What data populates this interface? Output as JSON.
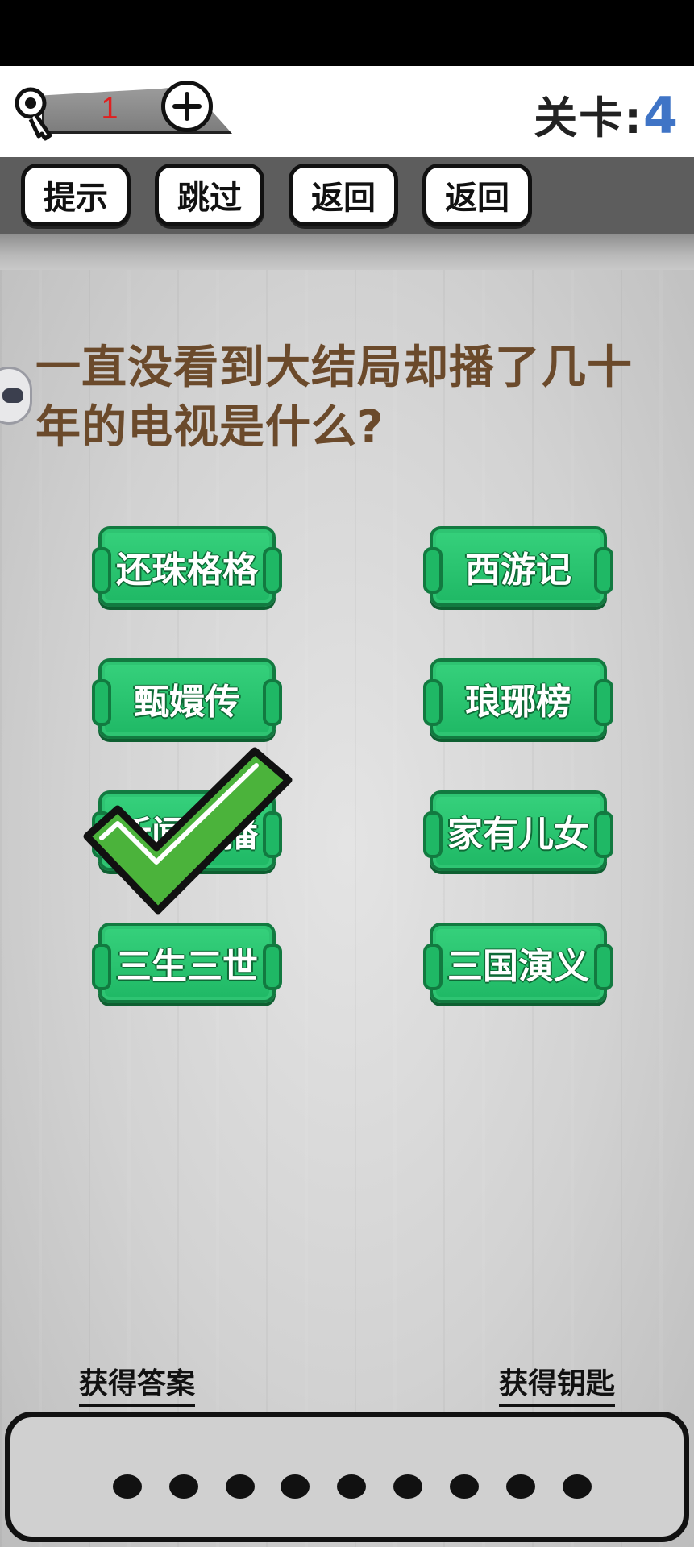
{
  "header": {
    "key_count": "1",
    "level_label": "关卡:",
    "level_number": "4"
  },
  "toolbar": {
    "buttons": [
      "提示",
      "跳过",
      "返回",
      "返回"
    ]
  },
  "question": {
    "text": "一直没看到大结局却播了几十年的电视是什么?"
  },
  "answers": [
    {
      "label": "还珠格格"
    },
    {
      "label": "西游记"
    },
    {
      "label": "甄嬛传"
    },
    {
      "label": "琅琊榜"
    },
    {
      "label": "新闻联播",
      "selected": true
    },
    {
      "label": "家有儿女"
    },
    {
      "label": "三生三世"
    },
    {
      "label": "三国演义"
    }
  ],
  "footer": {
    "get_answer": "获得答案",
    "get_key": "获得钥匙"
  },
  "answer_slots": 9,
  "colors": {
    "answer_green": "#22bb69",
    "check_green": "#4bb33b",
    "question_brown": "#6b4a2b",
    "level_blue": "#3f74c6",
    "key_count_red": "#e02020"
  }
}
